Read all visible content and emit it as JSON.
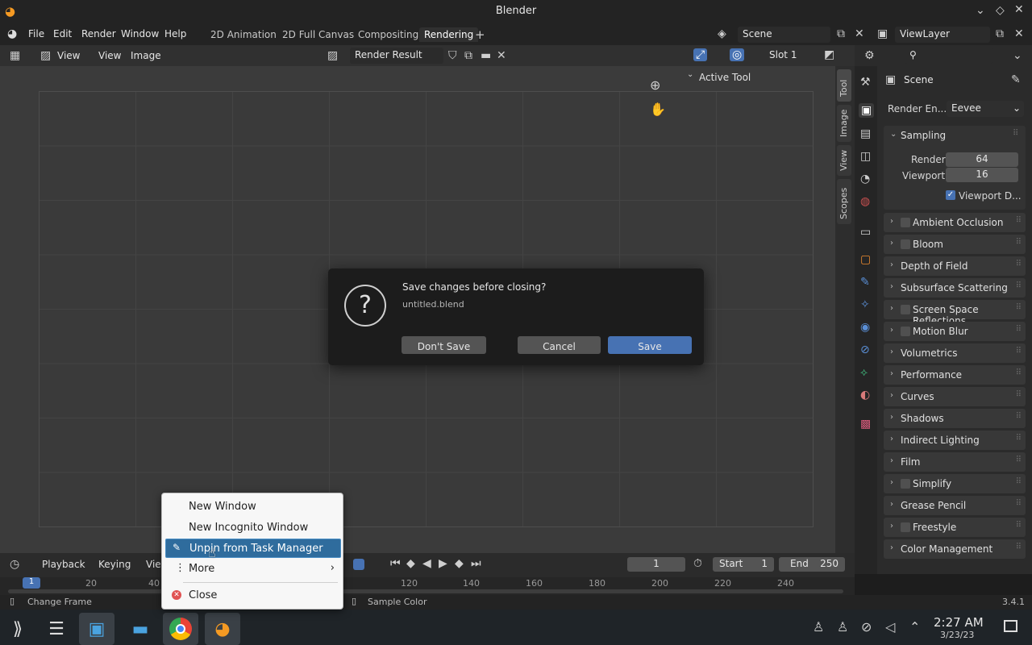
{
  "window": {
    "title": "Blender"
  },
  "menu": {
    "file": "File",
    "edit": "Edit",
    "render": "Render",
    "window": "Window",
    "help": "Help"
  },
  "workspaces": [
    "2D Animation",
    "2D Full Canvas",
    "Compositing",
    "Rendering"
  ],
  "top_right": {
    "scene": "Scene",
    "view_layer": "ViewLayer"
  },
  "image_editor": {
    "view": "View",
    "view2": "View",
    "image": "Image",
    "render_result": "Render Result",
    "slot": "Slot 1"
  },
  "npanel": {
    "active_tool": "Active Tool",
    "tabs": [
      "Tool",
      "Image",
      "View",
      "Scopes"
    ]
  },
  "properties": {
    "scene": "Scene",
    "render_engine_label": "Render En...",
    "render_engine": "Eevee",
    "sampling": "Sampling",
    "render_label": "Render",
    "render_value": "64",
    "viewport_label": "Viewport",
    "viewport_value": "16",
    "viewport_denoise": "Viewport D...",
    "panels": [
      {
        "label": "Ambient Occlusion",
        "checkbox": true
      },
      {
        "label": "Bloom",
        "checkbox": true
      },
      {
        "label": "Depth of Field",
        "checkbox": false
      },
      {
        "label": "Subsurface Scattering",
        "checkbox": false
      },
      {
        "label": "Screen Space Reflections",
        "checkbox": true
      },
      {
        "label": "Motion Blur",
        "checkbox": true
      },
      {
        "label": "Volumetrics",
        "checkbox": false
      },
      {
        "label": "Performance",
        "checkbox": false
      },
      {
        "label": "Curves",
        "checkbox": false
      },
      {
        "label": "Shadows",
        "checkbox": false
      },
      {
        "label": "Indirect Lighting",
        "checkbox": false
      },
      {
        "label": "Film",
        "checkbox": false
      },
      {
        "label": "Simplify",
        "checkbox": true
      },
      {
        "label": "Grease Pencil",
        "checkbox": false
      },
      {
        "label": "Freestyle",
        "checkbox": true
      },
      {
        "label": "Color Management",
        "checkbox": false
      }
    ]
  },
  "dialog": {
    "message": "Save changes before closing?",
    "filename": "untitled.blend",
    "dont_save": "Don't Save",
    "cancel": "Cancel",
    "save": "Save"
  },
  "timeline": {
    "playback": "Playback",
    "keying": "Keying",
    "view": "View",
    "current_frame": "1",
    "start_label": "Start",
    "start": "1",
    "end_label": "End",
    "end": "250",
    "ticks": [
      "1",
      "20",
      "40",
      "120",
      "140",
      "160",
      "180",
      "200",
      "220",
      "240"
    ]
  },
  "statusbar": {
    "change_frame": "Change Frame",
    "sample_color": "Sample Color",
    "version": "3.4.1"
  },
  "context_menu": {
    "new_window": "New Window",
    "new_incognito": "New Incognito Window",
    "unpin": "Unpin from Task Manager",
    "more": "More",
    "close": "Close"
  },
  "taskbar": {
    "time": "2:27 AM",
    "date": "3/23/23"
  }
}
